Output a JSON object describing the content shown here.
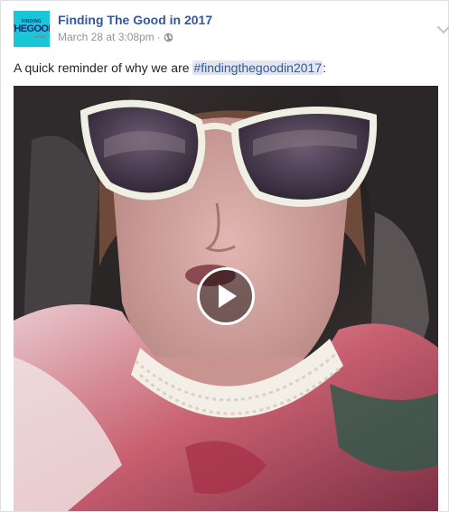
{
  "post": {
    "page_name": "Finding The Good in 2017",
    "timestamp": "March 28 at 3:08pm",
    "separator": "·",
    "privacy_icon": "globe-icon",
    "menu_icon": "chevron-down-icon",
    "text_before": "A quick reminder of why we are ",
    "hashtag": "#findingthegoodin2017",
    "text_after": ":"
  },
  "avatar": {
    "line1": "FINDING",
    "line2": "THEGOOD",
    "line3": "in 2017",
    "background": "#19c6d6"
  },
  "video": {
    "play_icon": "play-icon"
  },
  "colors": {
    "link": "#365899",
    "meta": "#90949c",
    "text": "#1d2129",
    "hashtag_bg": "#e1e5f0"
  }
}
